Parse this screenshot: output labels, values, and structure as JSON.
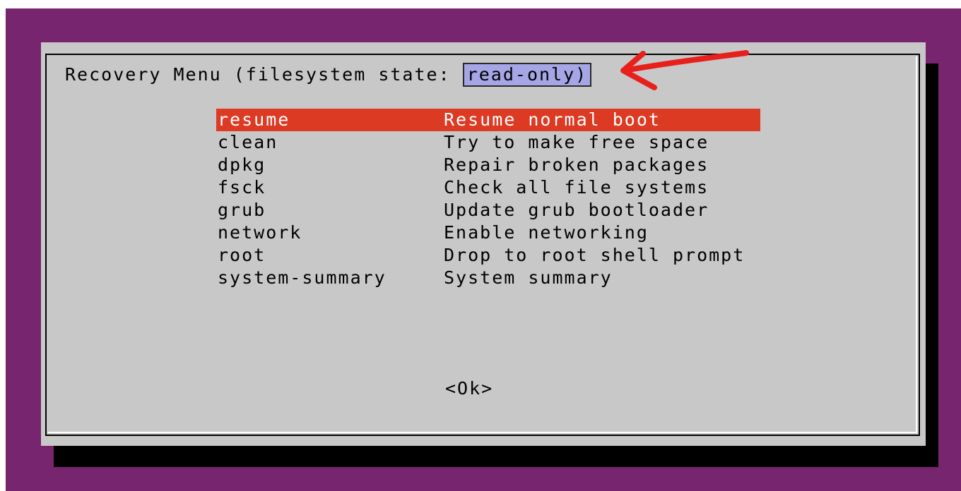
{
  "dialog": {
    "title_prefix": "Recovery Menu (filesystem state: ",
    "state_value": "read-only)",
    "ok_label": "<Ok>"
  },
  "menu": {
    "items": [
      {
        "key": "resume",
        "desc": "Resume normal boot",
        "selected": true
      },
      {
        "key": "clean",
        "desc": "Try to make free space",
        "selected": false
      },
      {
        "key": "dpkg",
        "desc": "Repair broken packages",
        "selected": false
      },
      {
        "key": "fsck",
        "desc": "Check all file systems",
        "selected": false
      },
      {
        "key": "grub",
        "desc": "Update grub bootloader",
        "selected": false
      },
      {
        "key": "network",
        "desc": "Enable networking",
        "selected": false
      },
      {
        "key": "root",
        "desc": "Drop to root shell prompt",
        "selected": false
      },
      {
        "key": "system-summary",
        "desc": "System summary",
        "selected": false
      }
    ]
  },
  "colors": {
    "background": "#76256e",
    "dialog": "#c8c8c8",
    "selection": "#dd3a24",
    "state_highlight": "#a6a6e6",
    "annotation_arrow": "#e8201c"
  },
  "icons": {
    "annotation": "red-arrow-icon"
  }
}
